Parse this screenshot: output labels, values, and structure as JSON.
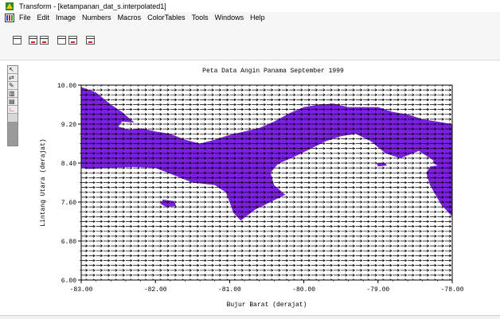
{
  "window": {
    "title": "Transform - [ketampanan_dat_s.interpolated1]"
  },
  "menu": {
    "items": [
      "File",
      "Edit",
      "Image",
      "Numbers",
      "Macros",
      "ColorTables",
      "Tools",
      "Windows",
      "Help"
    ]
  },
  "icons": {
    "app": "transform-app-icon",
    "menu": "image-window-icon",
    "toolbar": [
      "plot-axes-icon",
      "table-icon",
      "column-table-icon",
      "image-icon",
      "sub-table-icon",
      "window-icon"
    ],
    "palette": [
      "arrow-pointer-icon",
      "zoom-icon",
      "pencil-icon",
      "profile-icon",
      "layers-icon",
      "axis-plot-icon"
    ]
  },
  "colors": {
    "land": "#7b1fe0",
    "vector": "#000000",
    "background": "#ffffff"
  },
  "chart_data": {
    "type": "vector-field",
    "title": "Peta Data Angin Panama September 1999",
    "xlabel": "Bujur Barat (derajat)",
    "ylabel": "Lintang Utara (derajat)",
    "xlim": [
      -83.0,
      -78.0
    ],
    "ylim": [
      6.0,
      10.0
    ],
    "xticks": [
      "-83.00",
      "-82.00",
      "-81.00",
      "-80.00",
      "-79.00",
      "-78.00"
    ],
    "yticks": [
      "10.00",
      "9.20",
      "8.40",
      "7.60",
      "6.80",
      "6.00"
    ],
    "grid": false,
    "vector_direction": "east",
    "vector_spacing": [
      0.1,
      0.1
    ],
    "land": {
      "name": "Panama",
      "mainland": [
        [
          -83.0,
          9.96
        ],
        [
          -82.8,
          9.85
        ],
        [
          -82.6,
          9.6
        ],
        [
          -82.45,
          9.45
        ],
        [
          -82.3,
          9.25
        ],
        [
          -82.2,
          9.12
        ],
        [
          -82.0,
          9.05
        ],
        [
          -81.8,
          9.0
        ],
        [
          -81.6,
          8.88
        ],
        [
          -81.4,
          8.8
        ],
        [
          -81.2,
          8.88
        ],
        [
          -81.0,
          8.98
        ],
        [
          -80.8,
          9.05
        ],
        [
          -80.6,
          9.12
        ],
        [
          -80.4,
          9.25
        ],
        [
          -80.2,
          9.42
        ],
        [
          -80.0,
          9.55
        ],
        [
          -79.8,
          9.6
        ],
        [
          -79.6,
          9.62
        ],
        [
          -79.4,
          9.55
        ],
        [
          -79.2,
          9.55
        ],
        [
          -79.0,
          9.55
        ],
        [
          -78.8,
          9.45
        ],
        [
          -78.6,
          9.4
        ],
        [
          -78.4,
          9.3
        ],
        [
          -78.2,
          9.25
        ],
        [
          -78.0,
          9.2
        ],
        [
          -78.0,
          7.3
        ],
        [
          -78.15,
          7.55
        ],
        [
          -78.3,
          7.95
        ],
        [
          -78.35,
          8.2
        ],
        [
          -78.25,
          8.45
        ],
        [
          -78.45,
          8.65
        ],
        [
          -78.7,
          8.5
        ],
        [
          -78.9,
          8.6
        ],
        [
          -79.1,
          8.85
        ],
        [
          -79.3,
          9.0
        ],
        [
          -79.5,
          8.95
        ],
        [
          -79.7,
          8.85
        ],
        [
          -79.9,
          8.7
        ],
        [
          -80.1,
          8.55
        ],
        [
          -80.35,
          8.38
        ],
        [
          -80.45,
          8.2
        ],
        [
          -80.4,
          7.95
        ],
        [
          -80.25,
          7.75
        ],
        [
          -80.45,
          7.6
        ],
        [
          -80.65,
          7.45
        ],
        [
          -80.85,
          7.22
        ],
        [
          -80.95,
          7.38
        ],
        [
          -81.0,
          7.6
        ],
        [
          -81.05,
          7.8
        ],
        [
          -81.2,
          7.95
        ],
        [
          -81.5,
          8.0
        ],
        [
          -81.75,
          8.15
        ],
        [
          -82.0,
          8.3
        ],
        [
          -82.3,
          8.32
        ],
        [
          -82.6,
          8.3
        ],
        [
          -82.9,
          8.28
        ],
        [
          -83.0,
          8.3
        ]
      ],
      "islands": [
        [
          [
            -81.9,
            7.65
          ],
          [
            -81.75,
            7.62
          ],
          [
            -81.72,
            7.52
          ],
          [
            -81.85,
            7.5
          ],
          [
            -81.93,
            7.56
          ]
        ],
        [
          [
            -79.02,
            8.4
          ],
          [
            -78.9,
            8.4
          ],
          [
            -78.88,
            8.35
          ],
          [
            -79.0,
            8.33
          ]
        ]
      ],
      "holes": [
        [
          [
            -82.45,
            9.25
          ],
          [
            -82.2,
            9.22
          ],
          [
            -82.15,
            9.12
          ],
          [
            -82.35,
            9.08
          ],
          [
            -82.5,
            9.15
          ]
        ],
        [
          [
            -78.6,
            8.4
          ],
          [
            -78.3,
            8.45
          ],
          [
            -78.2,
            8.35
          ],
          [
            -78.45,
            8.3
          ]
        ]
      ]
    }
  }
}
